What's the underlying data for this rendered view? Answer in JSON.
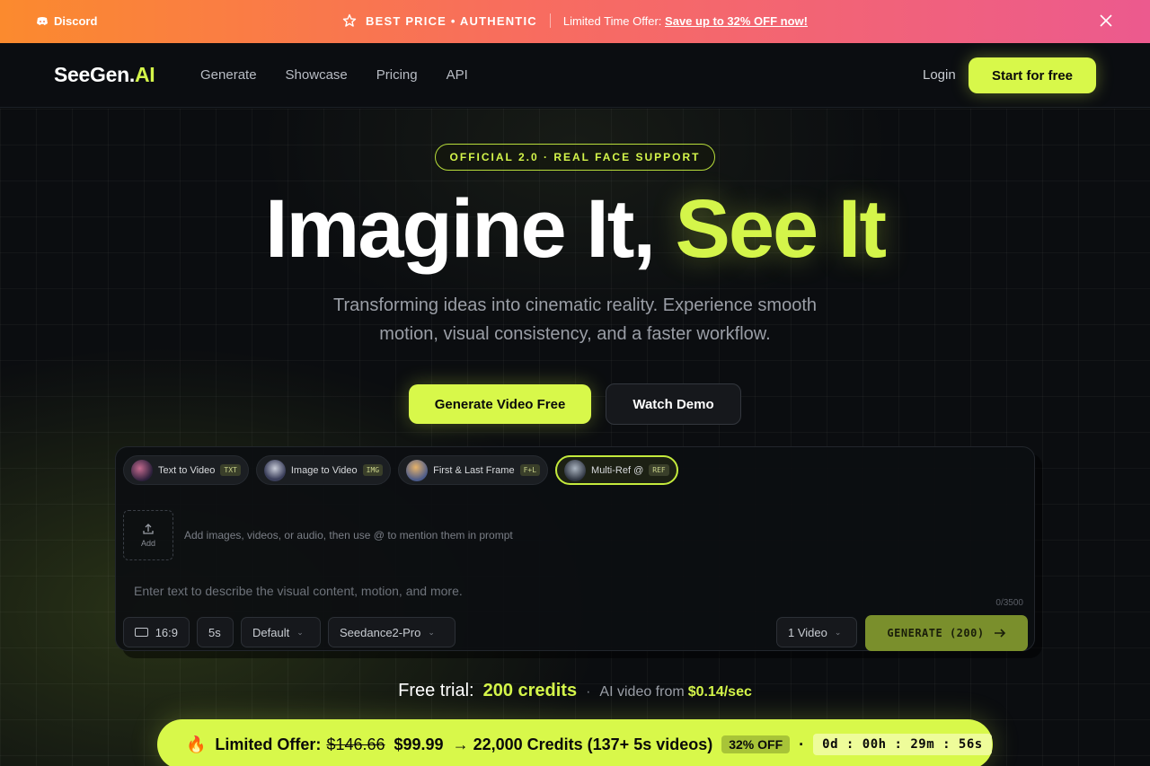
{
  "promo": {
    "discord": "Discord",
    "badge": "BEST PRICE • AUTHENTIC",
    "offer_prefix": "Limited Time Offer:",
    "offer_link": "Save up to 32% OFF now!"
  },
  "nav": {
    "logo_main": "SeeGen.",
    "logo_accent": "AI",
    "links": [
      "Generate",
      "Showcase",
      "Pricing",
      "API"
    ],
    "login": "Login",
    "cta": "Start for free"
  },
  "hero": {
    "badge": "OFFICIAL 2.0 · REAL FACE SUPPORT",
    "title_main": "Imagine It, ",
    "title_accent": "See It",
    "subtitle_line1": "Transforming ideas into cinematic reality. Experience smooth",
    "subtitle_line2": "motion, visual consistency, and a faster workflow.",
    "primary_button": "Generate Video Free",
    "secondary_button": "Watch Demo"
  },
  "generator": {
    "tabs": [
      {
        "label": "Text to Video",
        "tag": "TXT"
      },
      {
        "label": "Image to Video",
        "tag": "IMG"
      },
      {
        "label": "First & Last Frame",
        "tag": "F+L"
      },
      {
        "label": "Multi-Ref @",
        "tag": "REF"
      }
    ],
    "active_tab": "Multi-Ref @",
    "upload_label": "Add",
    "upload_hint": "Add images, videos, or audio, then use @ to mention them in prompt",
    "prompt_placeholder": "Enter text to describe the visual content, motion, and more.",
    "char_count": "0/3500",
    "ratio": "16:9",
    "duration": "5s",
    "style": "Default",
    "model": "Seedance2-Pro",
    "count": "1 Video",
    "generate_button": "GENERATE (200)"
  },
  "trial": {
    "prefix": "Free trial:",
    "credits": "200 credits",
    "dot": "·",
    "from": "AI video from",
    "rate": "$0.14/sec"
  },
  "offer": {
    "label": "Limited Offer:",
    "old_price": "$146.66",
    "new_price": "$99.99",
    "details": "→ 22,000 Credits (137+ 5s videos)",
    "discount": "32% OFF",
    "separator": "·",
    "timer": "0d : 00h : 29m : 56s"
  },
  "colors": {
    "accent": "#d4f54a",
    "promo_start": "#fb8a2e",
    "promo_end": "#ec5a8e",
    "background": "#0a0c0f"
  }
}
